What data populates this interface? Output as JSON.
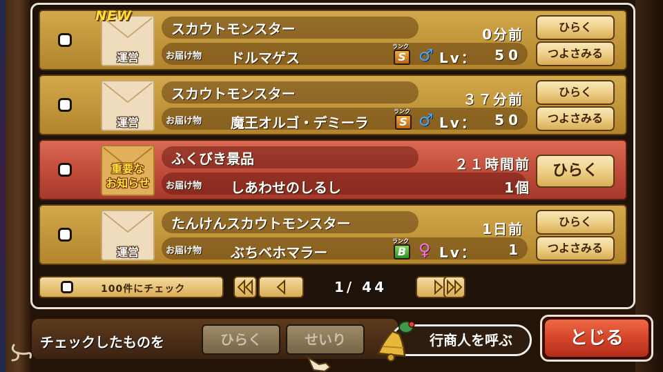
{
  "rows": [
    {
      "new_badge": "NEW",
      "envelope_label": "運営",
      "title": "スカウトモンスター",
      "time": "0分前",
      "gift_label": "お届け物",
      "item": "ドルマゲス",
      "rank_label": "ランク",
      "rank": "S",
      "sex": "♂",
      "lv_label": "Lv：",
      "lv": "50",
      "open_label": "ひらく",
      "strength_label": "つよさみる"
    },
    {
      "envelope_label": "運営",
      "title": "スカウトモンスター",
      "time": "３７分前",
      "gift_label": "お届け物",
      "item": "魔王オルゴ・デミーラ",
      "rank_label": "ランク",
      "rank": "S",
      "sex": "♂",
      "lv_label": "Lv：",
      "lv": "50",
      "open_label": "ひらく",
      "strength_label": "つよさみる"
    },
    {
      "envelope_label_line1": "重要な",
      "envelope_label_line2": "お知らせ",
      "title": "ふくびき景品",
      "time": "２１時間前",
      "gift_label": "お届け物",
      "item": "しあわせのしるし",
      "quantity": "1個",
      "open_label": "ひらく"
    },
    {
      "envelope_label": "運営",
      "title": "たんけんスカウトモンスター",
      "time": "1日前",
      "gift_label": "お届け物",
      "item": "ぶちベホマラー",
      "rank_label": "ランク",
      "rank": "B",
      "sex": "♀",
      "lv_label": "Lv：",
      "lv": "1",
      "open_label": "ひらく",
      "strength_label": "つよさみる"
    }
  ],
  "pager": {
    "check_all_label": "100件にチェック",
    "page_display": "1/ 44",
    "icons": [
      "double-left-arrow-icon",
      "left-arrow-icon",
      "right-arrow-icon",
      "double-right-arrow-icon"
    ]
  },
  "bottom": {
    "checked_label": "チェックしたものを",
    "open_label": "ひらく",
    "organize_label": "せいり",
    "merchant_label": "行商人を呼ぶ",
    "close_label": "とじる"
  },
  "colors": {
    "row_gold": "#c4983d",
    "row_red": "#c24d3b",
    "button_cream": "#efd08a",
    "close_red": "#d4442a",
    "male_blue": "#4aa4f0",
    "female_pink": "#f07ad8"
  }
}
